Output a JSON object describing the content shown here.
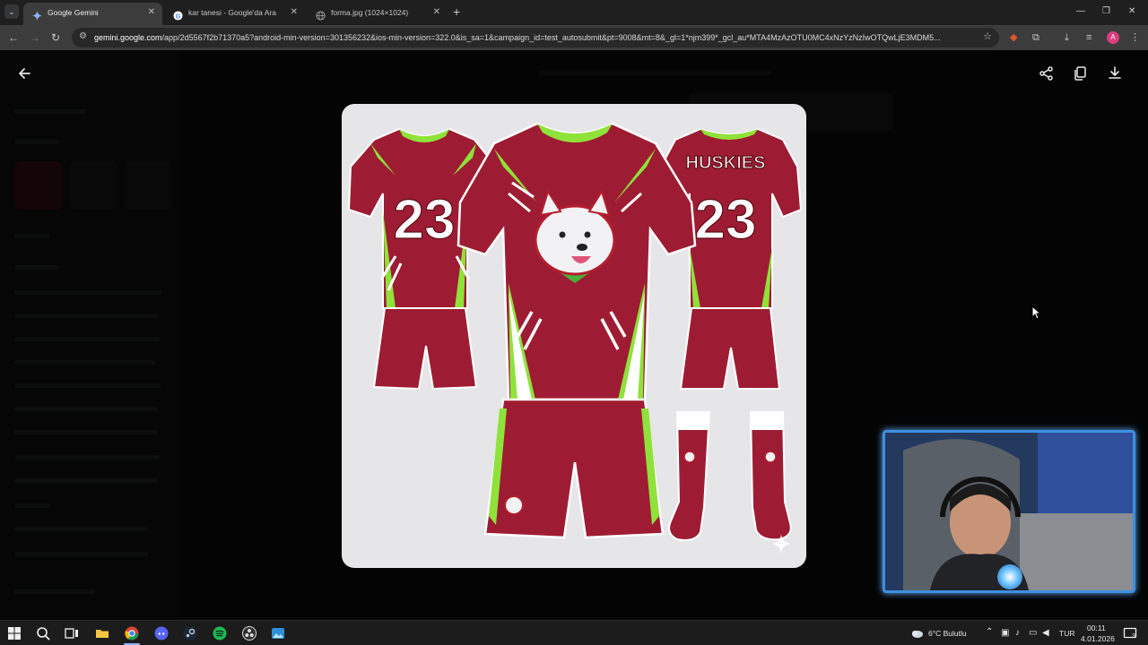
{
  "browser": {
    "tabs": [
      {
        "label": "Google Gemini",
        "active": true,
        "favicon": "gemini-sparkle-icon"
      },
      {
        "label": "kar tanesi - Google'da Ara",
        "active": false,
        "favicon": "google-g-icon"
      },
      {
        "label": "forma.jpg (1024×1024)",
        "active": false,
        "favicon": "globe-icon"
      }
    ],
    "url_host": "gemini.google.com",
    "url_rest": "/app/2d5567f2b71370a5?android-min-version=301356232&ios-min-version=322.0&is_sa=1&campaign_id=test_autosubmit&pt=9008&mt=8&_gl=1*njm399*_gcl_au*MTA4MzAzOTU0MC4xNzYzNzIwOTQwLjE3MDM5...",
    "profile_initial": "A",
    "accent": "#d93f7a"
  },
  "viewer": {
    "back_icon": "arrow-left-icon",
    "share_icon": "share-icon",
    "copy_icon": "copy-icon",
    "download_icon": "download-icon"
  },
  "image": {
    "back_name": "HUSKIES",
    "back_number": "23",
    "front_number": "23",
    "primary_color": "#9e1c33",
    "accent_color": "#8fe23a"
  },
  "taskbar": {
    "weather": "6°C Bulutlu",
    "language": "TUR",
    "time": "00:11",
    "date": "4.01.2026",
    "notification_count": "3"
  }
}
